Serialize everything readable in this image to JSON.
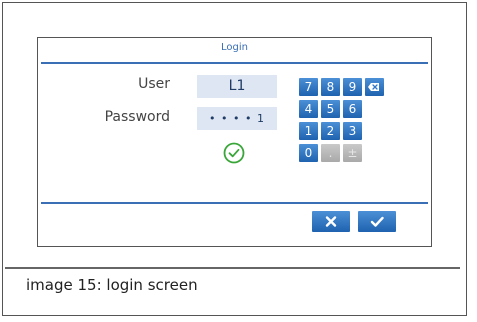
{
  "dialog": {
    "title": "Login",
    "user_label": "User",
    "user_value": "L1",
    "password_label": "Password",
    "password_value": "• • • • 1"
  },
  "keypad": {
    "rows": [
      [
        "7",
        "8",
        "9",
        "⌫"
      ],
      [
        "4",
        "5",
        "6"
      ],
      [
        "1",
        "2",
        "3"
      ],
      [
        "0",
        ".",
        "±"
      ]
    ],
    "disabled_keys": [
      "."
    ]
  },
  "actions": {
    "cancel_icon": "close-icon",
    "confirm_icon": "check-icon"
  },
  "caption": "image 15: login screen",
  "colors": {
    "accent": "#3a6fb5",
    "key_blue": "#2f77c7",
    "success_green": "#3aa63a"
  }
}
